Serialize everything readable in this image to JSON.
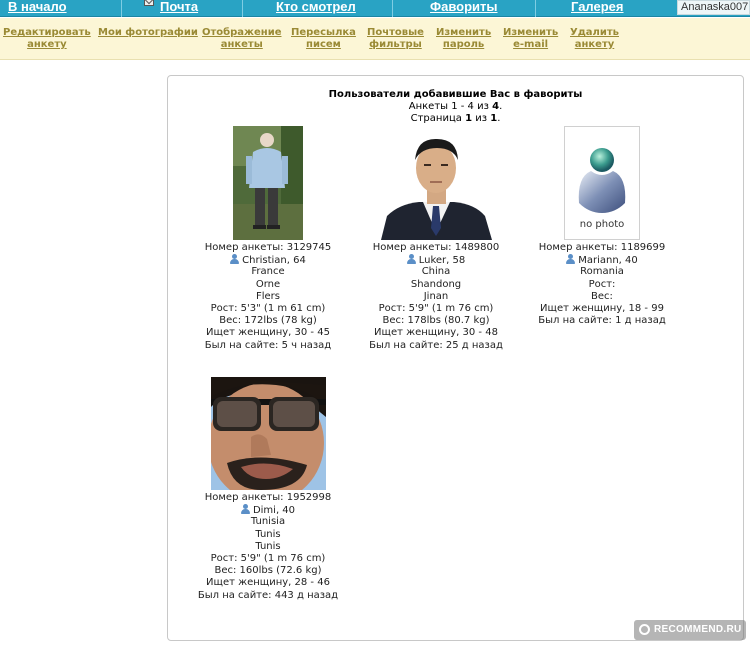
{
  "top_nav": {
    "items": [
      {
        "label": "В начало"
      },
      {
        "label": "Почта"
      },
      {
        "label": "Кто смотрел"
      },
      {
        "label": "Фавориты"
      },
      {
        "label": "Галерея"
      }
    ],
    "username": "Ananaska007",
    "background_color": "#29a3c4"
  },
  "sub_nav": {
    "items": [
      {
        "line1": "Редактировать",
        "line2": "анкету"
      },
      {
        "line1": "Мои фотографии",
        "line2": ""
      },
      {
        "line1": "Отображение",
        "line2": "анкеты"
      },
      {
        "line1": "Пересылка",
        "line2": "писем"
      },
      {
        "line1": "Почтовые",
        "line2": "фильтры"
      },
      {
        "line1": "Изменить",
        "line2": "пароль"
      },
      {
        "line1": "Изменить",
        "line2": "e-mail"
      },
      {
        "line1": "Удалить",
        "line2": "анкету"
      }
    ],
    "background_color": "#fcf6d6",
    "text_color": "#9a8a35"
  },
  "main": {
    "title": "Пользователи добавившие Вас в фавориты",
    "range_prefix": "Анкеты 1 - 4 из ",
    "range_total": "4",
    "range_suffix": ".",
    "page_prefix": "Страница ",
    "page_current": "1",
    "page_mid": " из ",
    "page_total": "1",
    "page_suffix": "."
  },
  "profiles": [
    {
      "number_line": "Номер анкеты: 3129745",
      "name": "Christian, 64",
      "country": "France",
      "region": "Orne",
      "city": "Flers",
      "height": "Рост: 5'3\" (1 m 61 cm)",
      "weight": "Вес: 172lbs (78 kg)",
      "seeking": "Ищет женщину, 30 - 45",
      "last_seen": "Был на сайте: 5 ч назад",
      "photo": "photo-elderly-man-in-garden"
    },
    {
      "number_line": "Номер анкеты: 1489800",
      "name": "Luker, 58",
      "country": "China",
      "region": "Shandong",
      "city": "Jinan",
      "height": "Рост: 5'9\" (1 m 76 cm)",
      "weight": "Вес: 178lbs (80.7 kg)",
      "seeking": "Ищет женщину, 30 - 48",
      "last_seen": "Был на сайте: 25 д назад",
      "photo": "photo-man-in-suit"
    },
    {
      "number_line": "Номер анкеты: 1189699",
      "name": "Mariann, 40",
      "country": "Romania",
      "region": "",
      "city": "",
      "height": "Рост:",
      "weight": "Вес:",
      "seeking": "Ищет женщину, 18 - 99",
      "last_seen": "Был на сайте: 1 д назад",
      "photo": "no-photo-placeholder",
      "photo_caption": "no photo"
    },
    {
      "number_line": "Номер анкеты: 1952998",
      "name": "Dimi, 40",
      "country": "Tunisia",
      "region": "Tunis",
      "city": "Tunis",
      "height": "Рост: 5'9\" (1 m 76 cm)",
      "weight": "Вес: 160lbs (72.6 kg)",
      "seeking": "Ищет женщину, 28 - 46",
      "last_seen": "Был на сайте: 443 д назад",
      "photo": "photo-man-in-sunglasses"
    }
  ],
  "watermark": "RECOMMEND.RU"
}
